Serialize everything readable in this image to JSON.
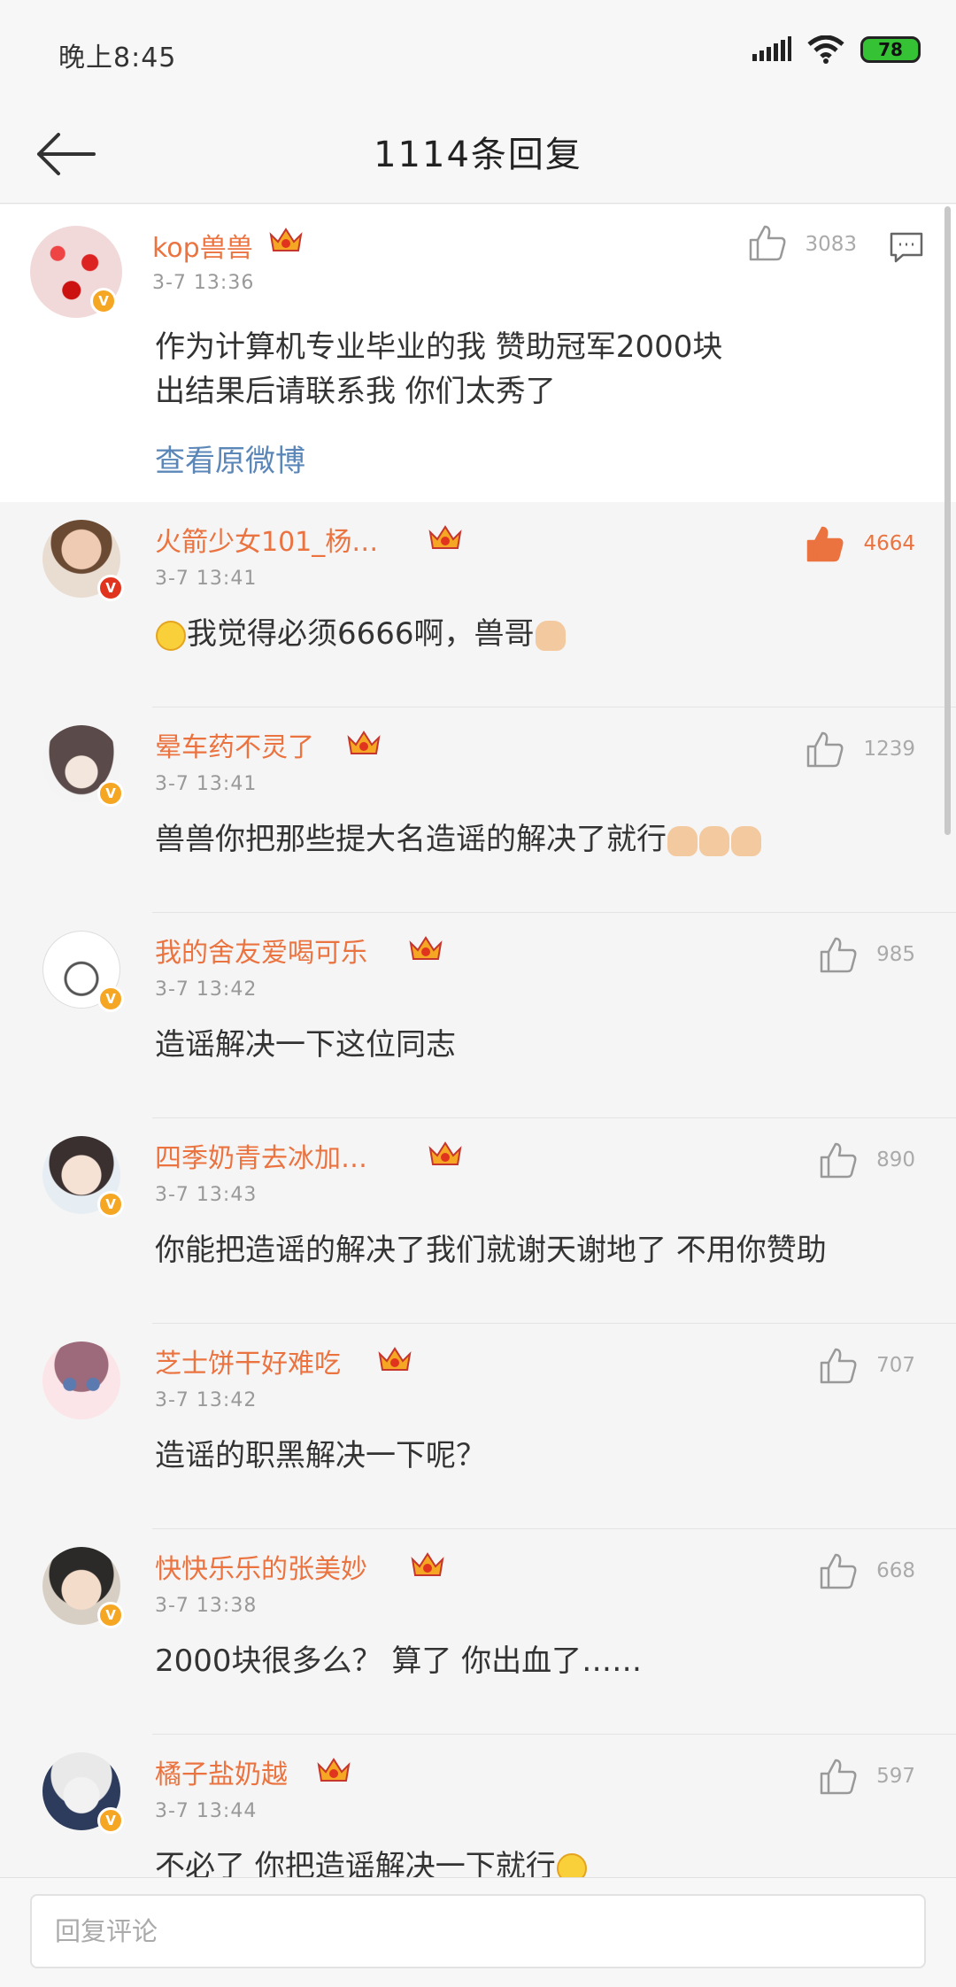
{
  "status_bar": {
    "time": "晚上8:45",
    "battery": "78"
  },
  "header": {
    "title": "1114条回复"
  },
  "root_comment": {
    "username": "kop兽兽",
    "timestamp": "3-7  13:36",
    "like_count": "3083",
    "content_lines": [
      "作为计算机专业毕业的我 赞助冠军2000块",
      "出结果后请联系我 你们太秀了"
    ],
    "view_original": "查看原微博"
  },
  "replies": [
    {
      "username": "火箭少女101_杨…",
      "timestamp": "3-7  13:41",
      "like_count": "4664",
      "liked": true,
      "content": "我觉得必须6666啊，兽哥"
    },
    {
      "username": "晕车药不灵了",
      "timestamp": "3-7  13:41",
      "like_count": "1239",
      "liked": false,
      "content": "兽兽你把那些提大名造谣的解决了就行"
    },
    {
      "username": "我的舍友爱喝可乐",
      "timestamp": "3-7  13:42",
      "like_count": "985",
      "liked": false,
      "content": "造谣解决一下这位同志"
    },
    {
      "username": "四季奶青去冰加…",
      "timestamp": "3-7  13:43",
      "like_count": "890",
      "liked": false,
      "content": "你能把造谣的解决了我们就谢天谢地了 不用你赞助"
    },
    {
      "username": "芝士饼干好难吃",
      "timestamp": "3-7  13:42",
      "like_count": "707",
      "liked": false,
      "content": "造谣的职黑解决一下呢？"
    },
    {
      "username": "快快乐乐的张美妙",
      "timestamp": "3-7  13:38",
      "like_count": "668",
      "liked": false,
      "content": "2000块很多么？ 算了 你出血了……"
    },
    {
      "username": "橘子盐奶越",
      "timestamp": "3-7  13:44",
      "like_count": "597",
      "liked": false,
      "content": "不必了  你把造谣解决一下就行"
    }
  ],
  "input": {
    "placeholder": "回复评论"
  },
  "colors": {
    "accent": "#eb7340",
    "link": "#5b86b8",
    "liked": "#eb7340"
  }
}
